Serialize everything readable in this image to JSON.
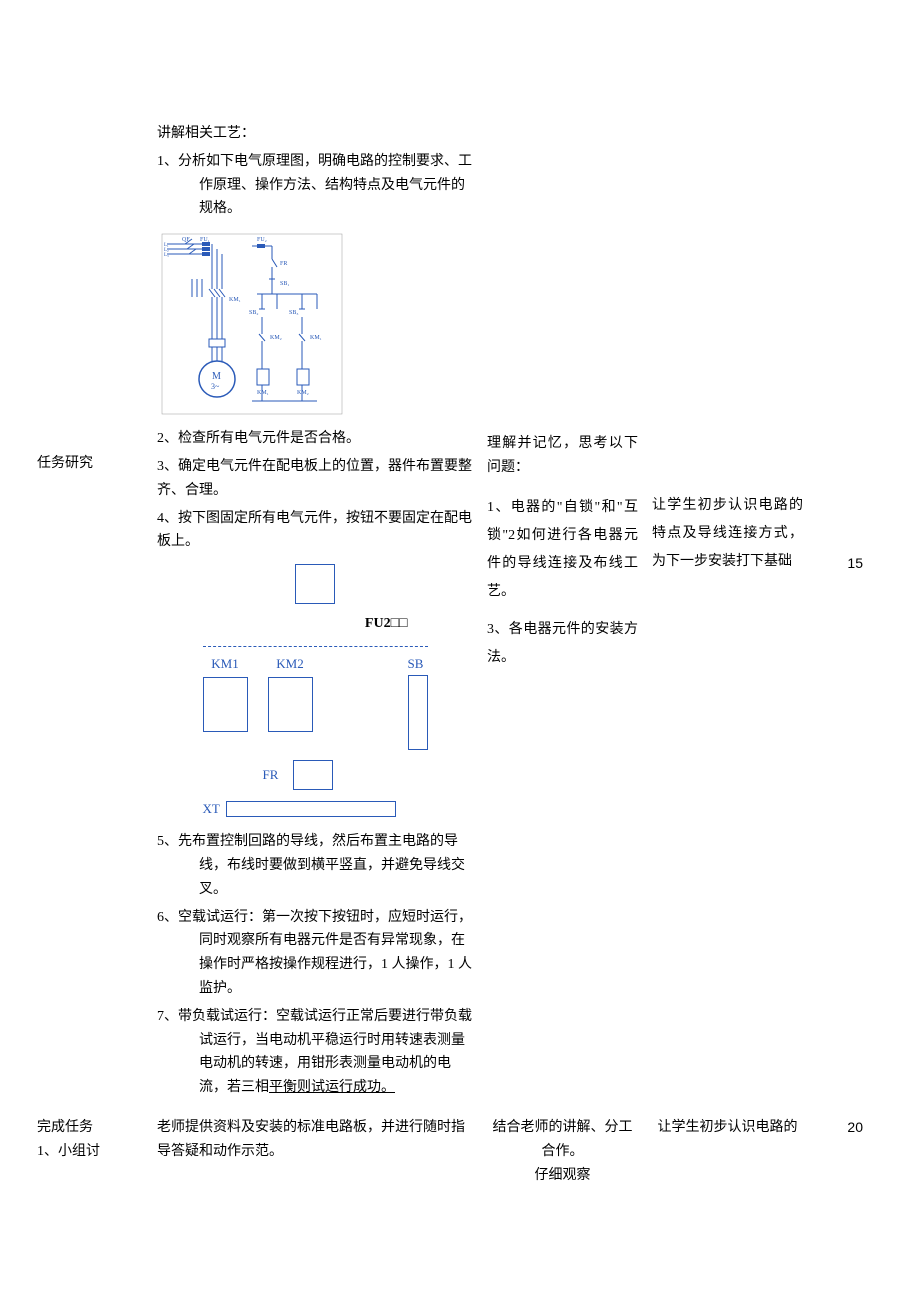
{
  "row1": {
    "col1": {
      "label": "任务研究"
    },
    "col2": {
      "intro": "讲解相关工艺：",
      "item1": "1、分析如下电气原理图，明确电路的控制要求、工作原理、操作方法、结构特点及电气元件的规格。",
      "item2": "2、检查所有电气元件是否合格。",
      "item3": "3、确定电气元件在配电板上的位置，器件布置要整齐、合理。",
      "item4": "4、按下图固定所有电气元件，按钮不要固定在配电板上。",
      "fu2": "FU2□□",
      "km1": "KM1",
      "km2": "KM2",
      "sb": "SB",
      "fr": "FR",
      "xt": "XT",
      "item5": "5、先布置控制回路的导线，然后布置主电路的导线，布线时要做到横平竖直，并避免导线交叉。",
      "item6": "6、空载试运行：第一次按下按钮时，应短时运行，同时观察所有电器元件是否有异常现象，在操作时严格按操作规程进行，1 人操作，1 人监护。",
      "item7_a": "7、带负载试运行：空载试运行正常后要进行带负载试运行，当电动机平稳运行时用转速表测量电动机的转速，用钳形表测量电动机的电流，若三相",
      "item7_u": "平衡则试运行成功。",
      "circuit_labels": {
        "qf": "QF",
        "fu1": "FU1",
        "fu2": "FU2",
        "fr": "FR",
        "sb1": "SB1",
        "sb2": "SB2",
        "sb3": "SB3",
        "km1": "KM1",
        "km2": "KM2",
        "m": "M",
        "m3": "3~",
        "l1": "L1",
        "l2": "L2",
        "l3": "L3"
      }
    },
    "col3": {
      "line1": "理解并记忆，思考以下问题：",
      "line2": "1、电器的\"自锁\"和\"互锁\"2如何进行各电器元件的导线连接及布线工艺。",
      "line3": "3、各电器元件的安装方法。"
    },
    "col4": {
      "text": "让学生初步认识电路的特点及导线连接方式，为下一步安装打下基础"
    },
    "col5": {
      "value": "15"
    }
  },
  "row2": {
    "col1": {
      "line1": "完成任务",
      "line2": "1、小组讨"
    },
    "col2": {
      "text": "老师提供资料及安装的标准电路板，并进行随时指导答疑和动作示范。"
    },
    "col3": {
      "line1": "结合老师的讲解、分工合作。",
      "line2": "仔细观察"
    },
    "col4": {
      "text": "让学生初步认识电路的"
    },
    "col5": {
      "value": "20"
    }
  }
}
